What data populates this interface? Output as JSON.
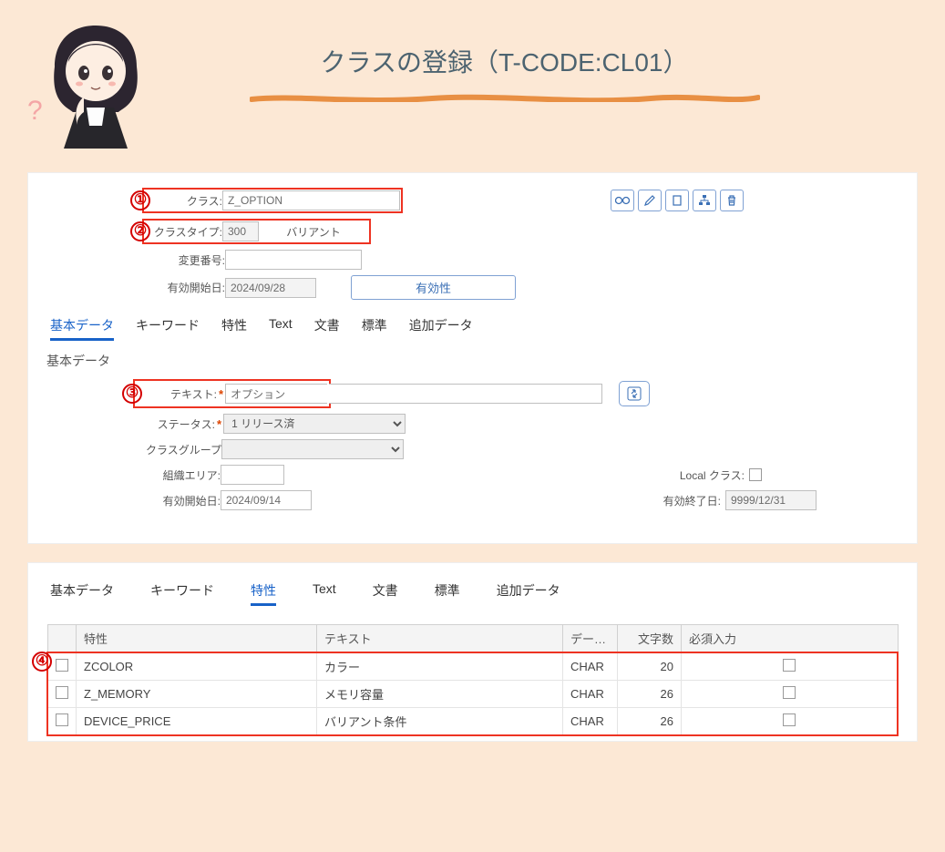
{
  "title": "クラスの登録（T-CODE:CL01）",
  "callouts": [
    "①",
    "②",
    "③",
    "④"
  ],
  "header": {
    "class_label": "クラス:",
    "class_value": "Z_OPTION",
    "classtype_label": "クラスタイプ:",
    "classtype_value": "300",
    "variant_label": "バリアント",
    "changeno_label": "変更番号:",
    "validfrom_label": "有効開始日:",
    "validfrom_value": "2024/09/28",
    "validity_btn": "有効性",
    "icons": [
      "glasses-icon",
      "pencil-icon",
      "copy-icon",
      "hierarchy-icon",
      "trash-icon"
    ]
  },
  "tabs1": [
    "基本データ",
    "キーワード",
    "特性",
    "Text",
    "文書",
    "標準",
    "追加データ"
  ],
  "tabs1_active": 0,
  "section1_title": "基本データ",
  "basic": {
    "text_label": "テキスト:",
    "text_value": "オプション",
    "status_label": "ステータス:",
    "status_value": "1 リリース済",
    "classgrp_label": "クラスグループ",
    "classgrp_value": "",
    "orgarea_label": "組織エリア:",
    "orgarea_value": "",
    "localclass_label": "Local クラス:",
    "validfrom2_label": "有効開始日:",
    "validfrom2_value": "2024/09/14",
    "validto_label": "有効終了日:",
    "validto_value": "9999/12/31"
  },
  "tabs2": [
    "基本データ",
    "キーワード",
    "特性",
    "Text",
    "文書",
    "標準",
    "追加データ"
  ],
  "tabs2_active": 2,
  "table": {
    "headers": [
      "",
      "特性",
      "テキスト",
      "デー…",
      "文字数",
      "必須入力"
    ],
    "rows": [
      {
        "char": "ZCOLOR",
        "text": "カラー",
        "dtype": "CHAR",
        "len": "20",
        "req": false
      },
      {
        "char": "Z_MEMORY",
        "text": "メモリ容量",
        "dtype": "CHAR",
        "len": "26",
        "req": false
      },
      {
        "char": "DEVICE_PRICE",
        "text": "バリアント条件",
        "dtype": "CHAR",
        "len": "26",
        "req": false
      }
    ]
  }
}
